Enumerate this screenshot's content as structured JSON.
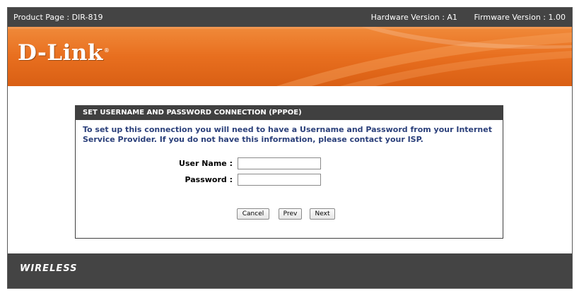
{
  "topbar": {
    "product": "Product Page : DIR-819",
    "hardware_version": "Hardware Version : A1",
    "firmware_version": "Firmware Version : 1.00"
  },
  "banner": {
    "brand": "D-Link",
    "trademark": "®",
    "color": "#e86f1f"
  },
  "panel": {
    "title": "SET USERNAME AND PASSWORD CONNECTION (PPPOE)",
    "instructions": "To set up this connection you will need to have a Username and Password from your Internet Service Provider. If you do not have this information, please contact your ISP.",
    "username_label": "User Name :",
    "username_value": "",
    "password_label": "Password :",
    "password_value": "",
    "buttons": {
      "cancel": "Cancel",
      "prev": "Prev",
      "next": "Next"
    }
  },
  "footer": {
    "label": "WIRELESS"
  },
  "colors": {
    "header_dark": "#444444",
    "accent_orange": "#e86f1f",
    "instruction_text": "#2a3f7a"
  }
}
